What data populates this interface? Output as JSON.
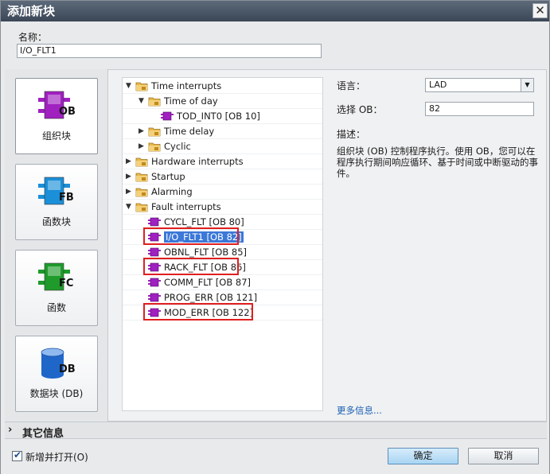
{
  "window": {
    "title": "添加新块",
    "close_glyph": "✕"
  },
  "name_field": {
    "label": "名称：",
    "value": "I/O_FLT1"
  },
  "block_types": [
    {
      "label": "组织块",
      "badge": "OB",
      "color": "#a020c0"
    },
    {
      "label": "函数块",
      "badge": "FB",
      "color": "#1b8fd8"
    },
    {
      "label": "函数",
      "badge": "FC",
      "color": "#1e9b2a"
    },
    {
      "label": "数据块 (DB)",
      "badge": "DB",
      "color": "#1f66c9"
    }
  ],
  "tree": [
    {
      "text": "Time interrupts",
      "type": "folder",
      "expanded": true
    },
    {
      "text": "Time of day",
      "type": "folder",
      "expanded": true
    },
    {
      "text": "TOD_INT0 [OB 10]",
      "type": "block"
    },
    {
      "text": "Time delay",
      "type": "folder",
      "expanded": false
    },
    {
      "text": "Cyclic",
      "type": "folder",
      "expanded": false
    },
    {
      "text": "Hardware interrupts",
      "type": "folder",
      "expanded": false
    },
    {
      "text": "Startup",
      "type": "folder",
      "expanded": false
    },
    {
      "text": "Alarming",
      "type": "folder",
      "expanded": false
    },
    {
      "text": "Fault interrupts",
      "type": "folder",
      "expanded": true
    },
    {
      "text": "CYCL_FLT [OB 80]",
      "type": "block"
    },
    {
      "text": "I/O_FLT1 [OB 82]",
      "type": "block",
      "selected": true,
      "highlighted": true
    },
    {
      "text": "OBNL_FLT [OB 85]",
      "type": "block"
    },
    {
      "text": "RACK_FLT [OB 86]",
      "type": "block",
      "highlighted": true
    },
    {
      "text": "COMM_FLT [OB 87]",
      "type": "block"
    },
    {
      "text": "PROG_ERR [OB 121]",
      "type": "block"
    },
    {
      "text": "MOD_ERR [OB 122]",
      "type": "block",
      "highlighted": true
    }
  ],
  "properties": {
    "language_label": "语言：",
    "language_value": "LAD",
    "ob_label": "选择 OB：",
    "ob_value": "82",
    "description_label": "描述：",
    "description_text": "组织块 (OB) 控制程序执行。使用 OB，您可以在程序执行期间响应循环、基于时间或中断驱动的事件。",
    "more_info": "更多信息..."
  },
  "other_info": {
    "label": "其它信息",
    "chevron": "›"
  },
  "footer": {
    "add_and_open_label": "新增并打开(O)",
    "add_and_open_checked": true,
    "ok_label": "确定",
    "cancel_label": "取消"
  },
  "colors": {
    "highlight_box": "#e01f1f",
    "selected_row": "#3b78d8",
    "ob_purple": "#a020c0"
  }
}
